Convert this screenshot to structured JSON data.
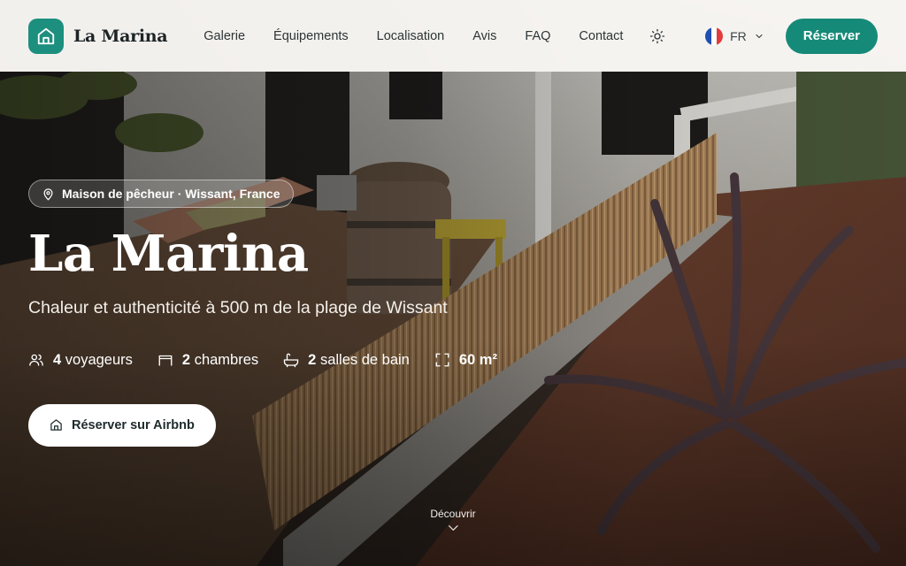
{
  "header": {
    "logo_text": "La Marina",
    "nav": [
      {
        "label": "Galerie"
      },
      {
        "label": "Équipements"
      },
      {
        "label": "Localisation"
      },
      {
        "label": "Avis"
      },
      {
        "label": "FAQ"
      },
      {
        "label": "Contact"
      }
    ],
    "language": "FR",
    "reserve_label": "Réserver"
  },
  "hero": {
    "location": "Maison de pêcheur · Wissant, France",
    "title": "La Marina",
    "subtitle": "Chaleur et authenticité à 500 m de la plage de Wissant",
    "features": [
      {
        "icon": "users-icon",
        "value": "4",
        "label": "voyageurs"
      },
      {
        "icon": "bed-icon",
        "value": "2",
        "label": "chambres"
      },
      {
        "icon": "bath-icon",
        "value": "2",
        "label": "salles de bain"
      },
      {
        "icon": "area-icon",
        "value": "60 m²",
        "label": ""
      }
    ],
    "cta_label": "Réserver sur Airbnb",
    "discover_label": "Découvrir"
  },
  "colors": {
    "accent": "#168a78",
    "header_bg": "#f8f6f3"
  }
}
